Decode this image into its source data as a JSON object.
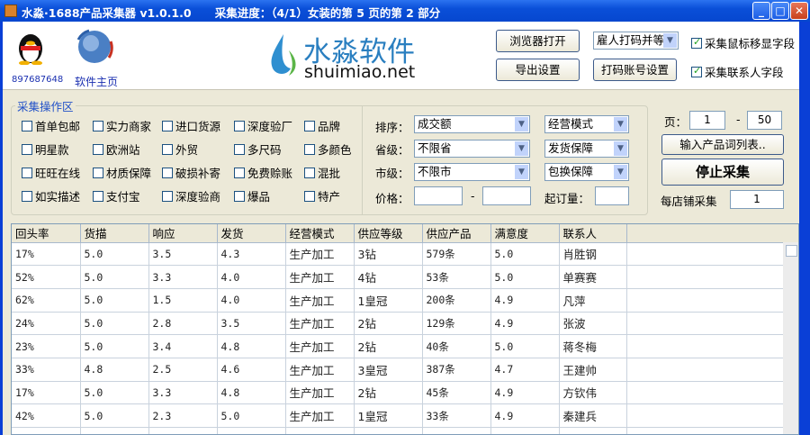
{
  "window": {
    "title": "水淼·1688产品采集器 v1.0.1.0",
    "progress": "采集进度：（4/1）女装的第 5 页的第 2 部分",
    "minimize": "_",
    "maximize": "□",
    "close": "✕"
  },
  "header": {
    "qq_number": "897687648",
    "homepage": "软件主页",
    "logo_cn": "水淼软件",
    "logo_en": "shuimiao.net",
    "browser_btn": "浏览器打开",
    "export_btn": "导出设置",
    "captcha_select": "雇人打码并等",
    "captcha_account_btn": "打码账号设置",
    "opt_mouse": "采集鼠标移显字段",
    "opt_contact": "采集联系人字段"
  },
  "filters": {
    "group_title": "采集操作区",
    "checkboxes": [
      "首单包邮",
      "实力商家",
      "进口货源",
      "深度验厂",
      "品牌",
      "明星款",
      "欧洲站",
      "外贸",
      "多尺码",
      "多颜色",
      "旺旺在线",
      "材质保障",
      "破损补寄",
      "免费赊账",
      "混批",
      "如实描述",
      "支付宝",
      "深度验商",
      "爆品",
      "特产"
    ],
    "sort_label": "排序：",
    "sort_value": "成交额",
    "province_label": "省级：",
    "province_value": "不限省",
    "city_label": "市级：",
    "city_value": "不限市",
    "price_label": "价格：",
    "price_min": "",
    "price_max": "",
    "dash": "-",
    "mode_value": "经营模式",
    "ship_value": "发货保障",
    "exchange_value": "包换保障",
    "moq_label": "起订量：",
    "moq_value": ""
  },
  "right": {
    "page_label": "页：",
    "page_from": "1",
    "page_to": "50",
    "dash": "-",
    "keyword_btn": "输入产品词列表..",
    "stop_btn": "停止采集",
    "per_shop_label": "每店铺采集",
    "per_shop_value": "1"
  },
  "table": {
    "headers": [
      "回头率",
      "货描",
      "响应",
      "发货",
      "经营模式",
      "供应等级",
      "供应产品",
      "满意度",
      "联系人"
    ],
    "rows": [
      [
        "17%",
        "5.0",
        "3.5",
        "4.3",
        "生产加工",
        "3钻",
        "579条",
        "5.0",
        "肖胜钢"
      ],
      [
        "52%",
        "5.0",
        "3.3",
        "4.0",
        "生产加工",
        "4钻",
        "53条",
        "5.0",
        "单赛赛"
      ],
      [
        "62%",
        "5.0",
        "1.5",
        "4.0",
        "生产加工",
        "1皇冠",
        "200条",
        "4.9",
        "凡萍"
      ],
      [
        "24%",
        "5.0",
        "2.8",
        "3.5",
        "生产加工",
        "2钻",
        "129条",
        "4.9",
        "张波"
      ],
      [
        "23%",
        "5.0",
        "3.4",
        "4.8",
        "生产加工",
        "2钻",
        "40条",
        "5.0",
        "蒋冬梅"
      ],
      [
        "33%",
        "4.8",
        "2.5",
        "4.6",
        "生产加工",
        "3皇冠",
        "387条",
        "4.7",
        "王建帅"
      ],
      [
        "17%",
        "5.0",
        "3.3",
        "4.8",
        "生产加工",
        "2钻",
        "45条",
        "4.9",
        "方钦伟"
      ],
      [
        "42%",
        "5.0",
        "2.3",
        "5.0",
        "生产加工",
        "1皇冠",
        "33条",
        "4.9",
        "秦建兵"
      ]
    ]
  }
}
